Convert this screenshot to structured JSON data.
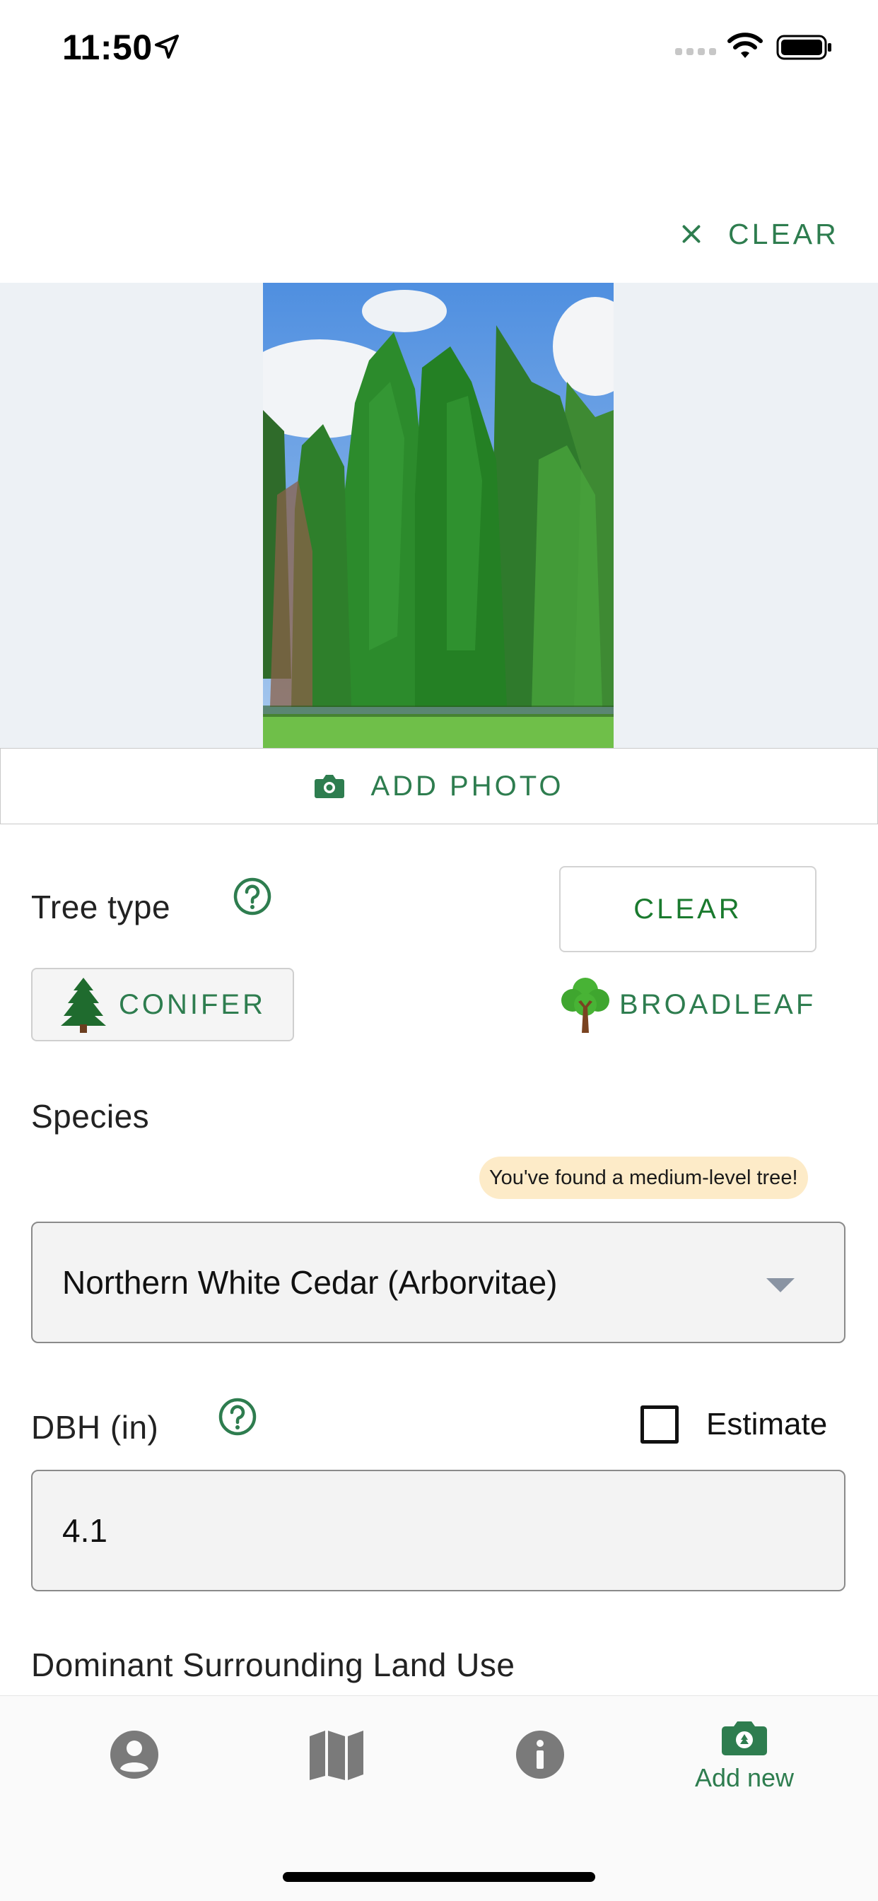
{
  "status_bar": {
    "time": "11:50"
  },
  "header": {
    "clear_label": "CLEAR"
  },
  "photo": {
    "add_photo_label": "ADD PHOTO"
  },
  "tree_type": {
    "label": "Tree type",
    "clear_label": "CLEAR",
    "options": [
      {
        "label": "CONIFER",
        "icon": "conifer-icon",
        "selected": true
      },
      {
        "label": "BROADLEAF",
        "icon": "broadleaf-icon",
        "selected": false
      }
    ]
  },
  "species": {
    "label": "Species",
    "badge": "You've found a medium-level tree!",
    "selected": "Northern White Cedar (Arborvitae)"
  },
  "dbh": {
    "label": "DBH (in)",
    "estimate_label": "Estimate",
    "estimate_checked": false,
    "value": "4.1"
  },
  "land_use": {
    "label": "Dominant Surrounding Land Use"
  },
  "tabbar": {
    "items": [
      {
        "icon": "profile-icon",
        "label": ""
      },
      {
        "icon": "map-icon",
        "label": ""
      },
      {
        "icon": "info-icon",
        "label": ""
      },
      {
        "icon": "add-new-camera-icon",
        "label": "Add new",
        "active": true
      }
    ]
  },
  "colors": {
    "accent": "#2e7d4f",
    "badge_bg": "#fdebc8",
    "photo_bg": "#edf1f5"
  }
}
